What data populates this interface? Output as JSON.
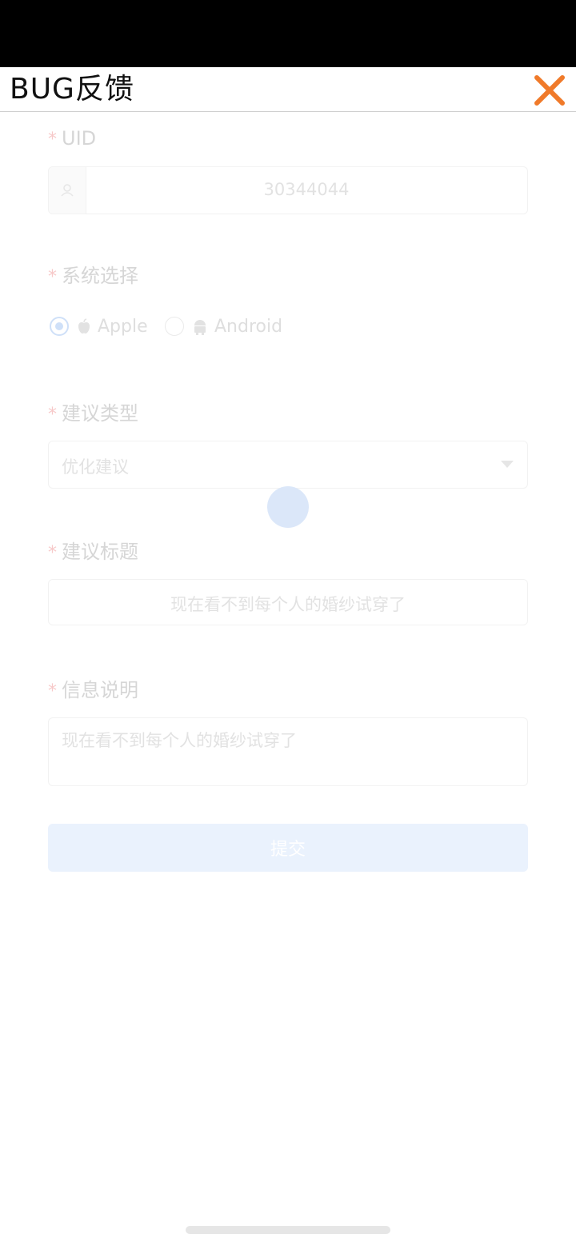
{
  "header": {
    "title": "BUG反馈"
  },
  "form": {
    "uid": {
      "label": "UID",
      "value": "30344044"
    },
    "system": {
      "label": "系统选择",
      "options": [
        {
          "label": "Apple",
          "icon": "apple-icon",
          "checked": true
        },
        {
          "label": "Android",
          "icon": "android-icon",
          "checked": false
        }
      ]
    },
    "type": {
      "label": "建议类型",
      "value": "优化建议"
    },
    "title": {
      "label": "建议标题",
      "value": "现在看不到每个人的婚纱试穿了"
    },
    "info": {
      "label": "信息说明",
      "value": "现在看不到每个人的婚纱试穿了"
    },
    "submit_label": "提交"
  },
  "colors": {
    "close": "#f07a2a",
    "accent_faded": "#cfe0f8"
  }
}
